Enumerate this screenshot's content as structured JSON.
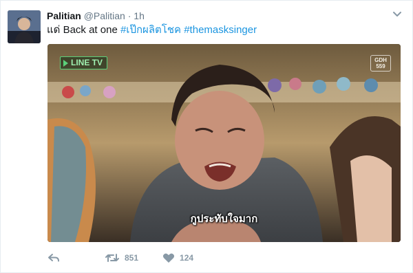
{
  "tweet": {
    "display_name": "Palitian",
    "handle": "@Palitian",
    "separator": "·",
    "time": "1h",
    "text_prefix": "แด่ Back at one",
    "hashtags": [
      "#เป๊กผลิตโชค",
      "#themasksinger"
    ],
    "media": {
      "watermark": "LINE TV",
      "channel_logo_line1": "GDH",
      "channel_logo_line2": "559",
      "subtitle": "กูประทับใจมาก"
    },
    "actions": {
      "reply_icon": "reply-icon",
      "retweet_icon": "retweet-icon",
      "like_icon": "heart-icon",
      "retweet_count": "851",
      "like_count": "124"
    }
  },
  "colors": {
    "hashtag": "#1b95e0",
    "muted": "#657786",
    "action": "#8899a6"
  }
}
